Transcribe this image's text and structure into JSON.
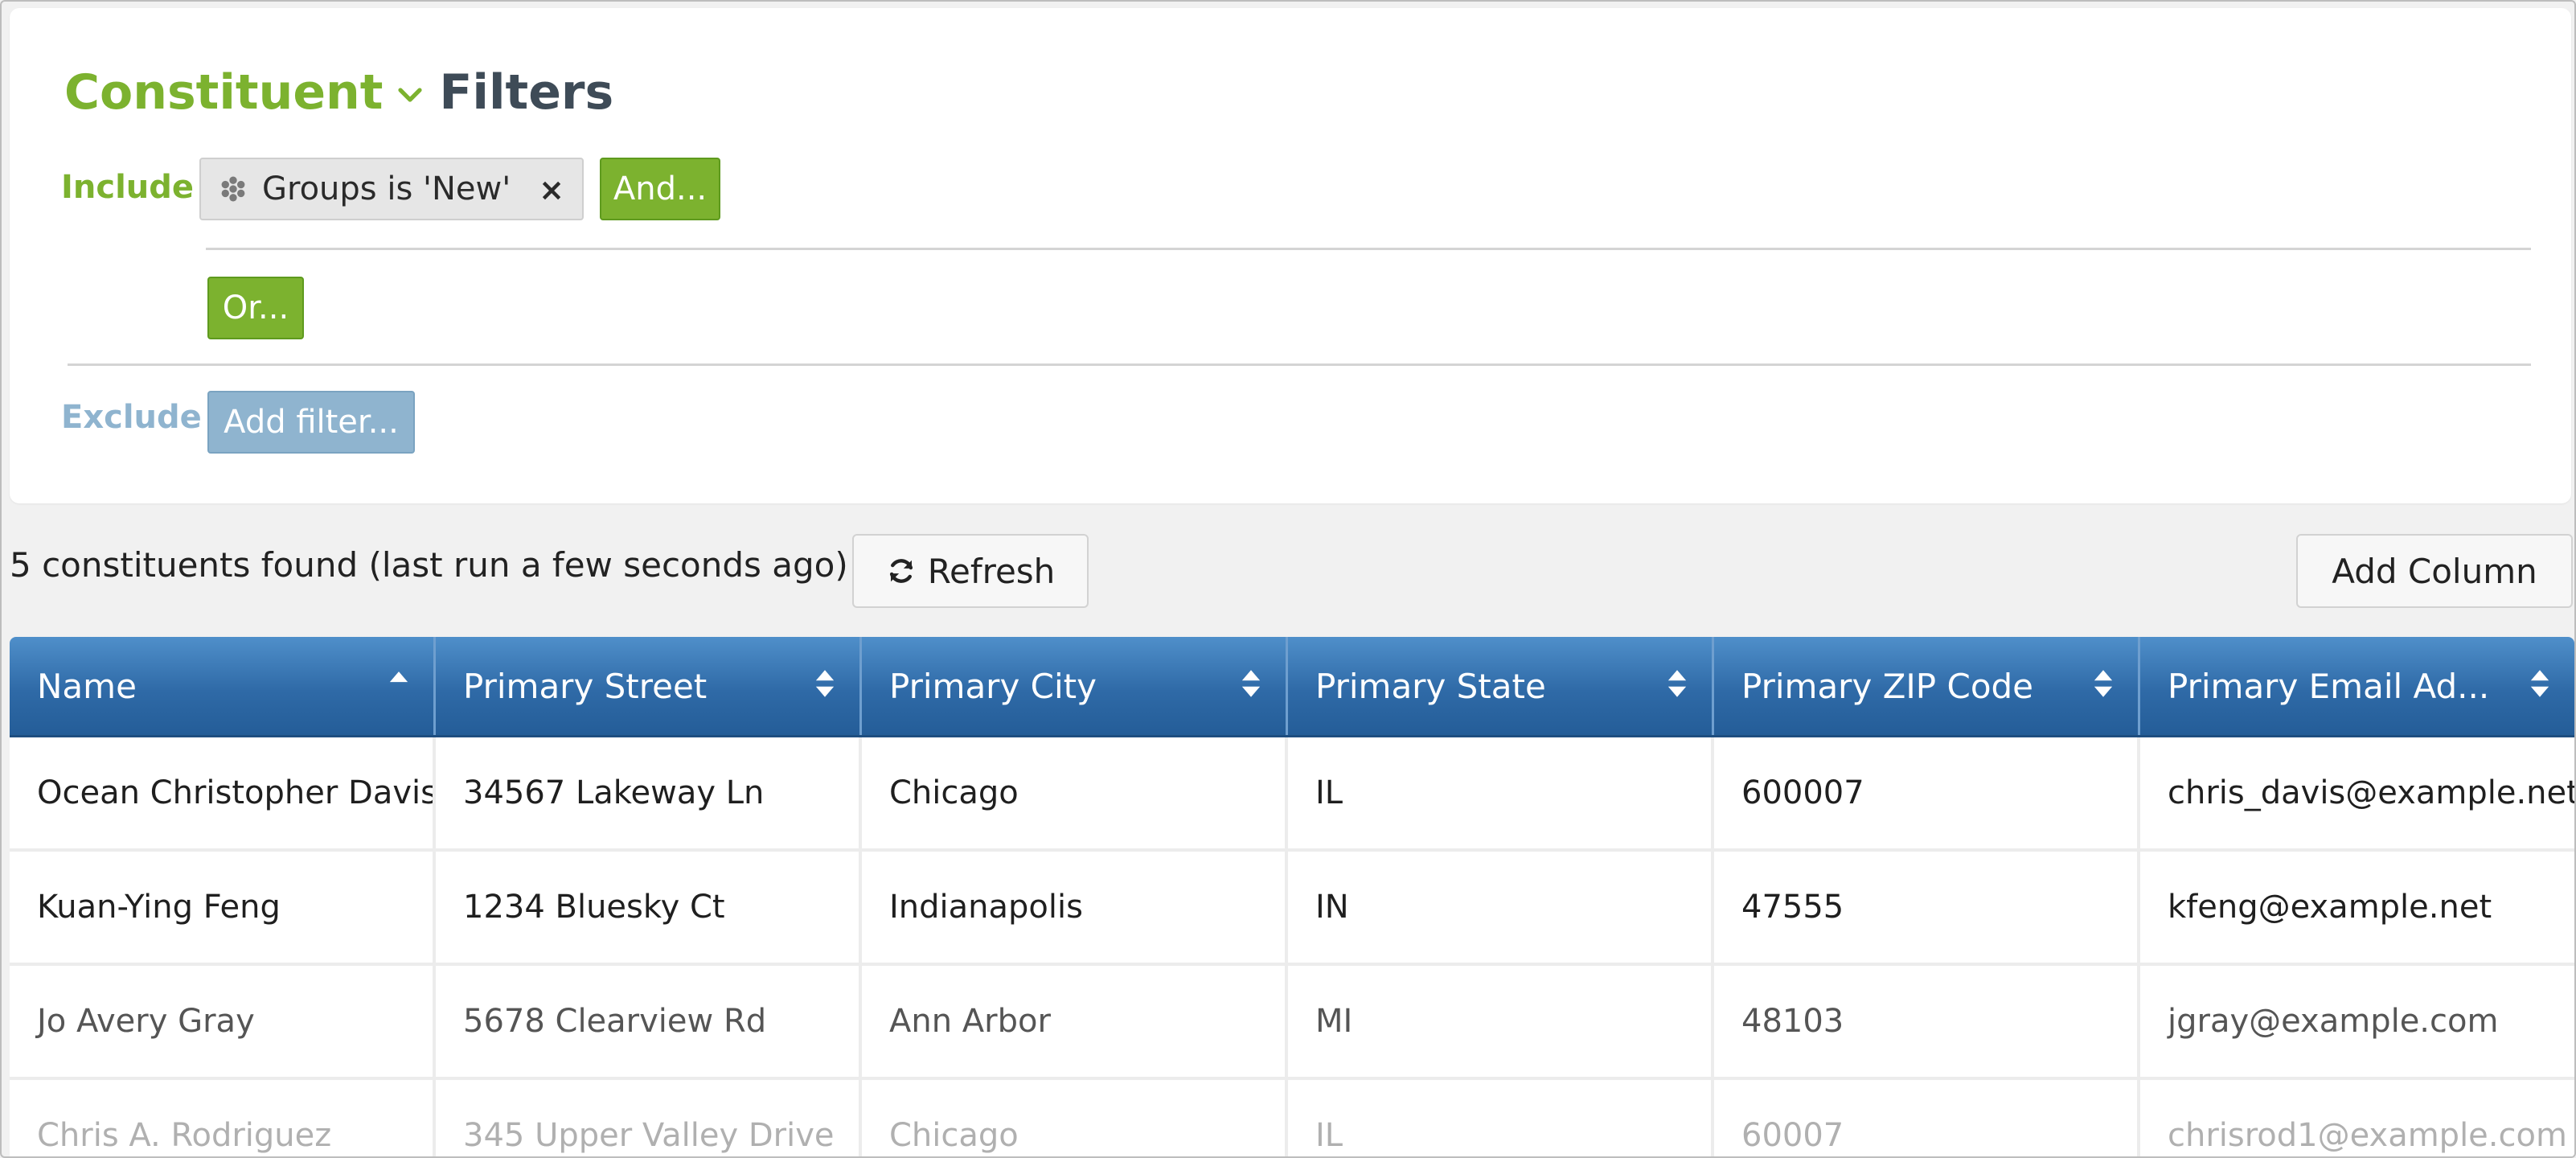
{
  "header": {
    "entity_label": "Constituent",
    "title_label": "Filters"
  },
  "filters": {
    "include_label": "Include",
    "exclude_label": "Exclude",
    "include_chip_text": "Groups is 'New'",
    "chip_close_glyph": "×",
    "and_button_label": "And...",
    "or_button_label": "Or...",
    "add_filter_label": "Add filter..."
  },
  "results": {
    "summary_text": "5 constituents found (last run a few seconds ago)",
    "refresh_label": "Refresh",
    "add_column_label": "Add Column"
  },
  "table": {
    "columns": [
      {
        "label": "Name",
        "sort": "ascending"
      },
      {
        "label": "Primary Street",
        "sort": "none"
      },
      {
        "label": "Primary City",
        "sort": "none"
      },
      {
        "label": "Primary State",
        "sort": "none"
      },
      {
        "label": "Primary ZIP Code",
        "sort": "none"
      },
      {
        "label": "Primary Email Ad...",
        "sort": "none"
      }
    ],
    "rows": [
      {
        "cells": [
          "Ocean Christopher Davis",
          "34567 Lakeway Ln",
          "Chicago",
          "IL",
          "600007",
          "chris_davis@example.net"
        ]
      },
      {
        "cells": [
          "Kuan-Ying Feng",
          "1234 Bluesky Ct",
          "Indianapolis",
          "IN",
          "47555",
          "kfeng@example.net"
        ]
      },
      {
        "cells": [
          "Jo Avery Gray",
          "5678 Clearview Rd",
          "Ann Arbor",
          "MI",
          "48103",
          "jgray@example.com"
        ]
      },
      {
        "cells": [
          "Chris A. Rodriguez",
          "345 Upper Valley Drive",
          "Chicago",
          "IL",
          "60007",
          "chrisrod1@example.com"
        ]
      }
    ]
  },
  "colors": {
    "accent_green": "#7cb22f",
    "exclude_blue": "#8fb4cf",
    "header_blue": "#2f6aa7",
    "title_slate": "#3e4b57"
  },
  "icons": {
    "title_dropdown": "chevron-down-icon",
    "chip": "group-icon",
    "chip_remove": "close-icon",
    "refresh": "refresh-icon",
    "sort_ascending": "sort-ascending-icon",
    "sort_none": "sort-icon"
  }
}
